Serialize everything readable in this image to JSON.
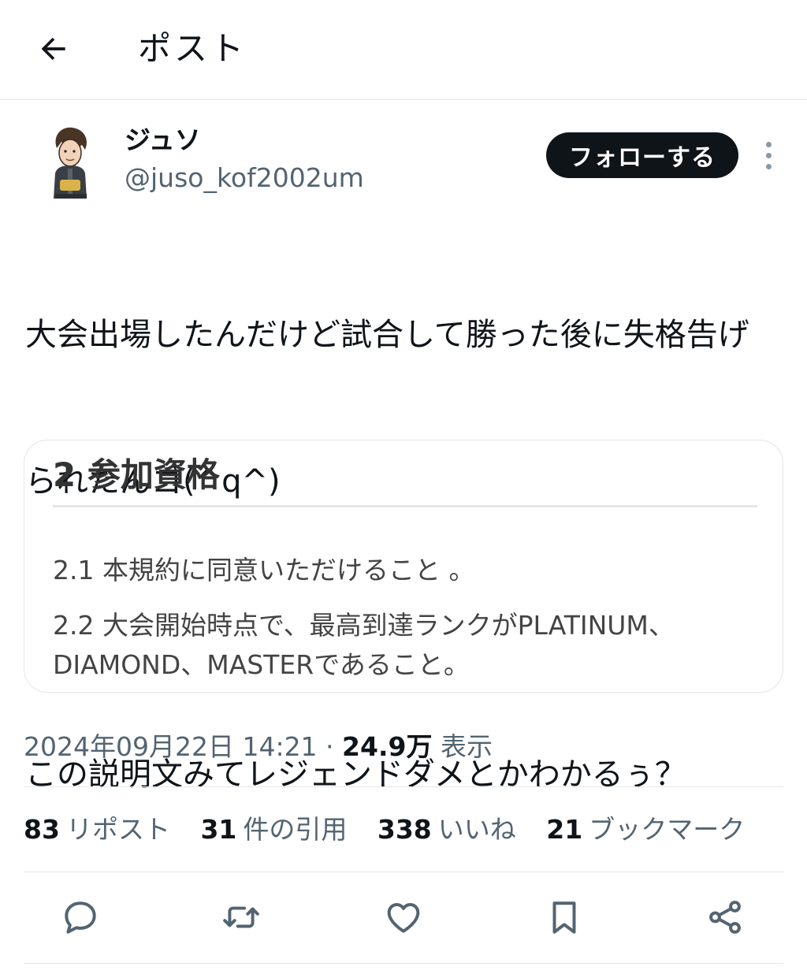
{
  "header": {
    "title": "ポスト"
  },
  "author": {
    "display_name": "ジュソ",
    "handle": "@juso_kof2002um",
    "follow_label": "フォローする"
  },
  "tweet": {
    "line1": "大会出場したんだけど試合して勝った後に失格告げ",
    "line2": "られたんゴ(^q^)",
    "line3": "この説明文みてレジェンドダメとかわかるぅ？"
  },
  "card": {
    "heading": "2 参加資格",
    "item1": "2.1 本規約に同意いただけること 。",
    "item2": "2.2 大会開始時点で、最高到達ランクがPLATINUM、DIAMOND、MASTERであること。"
  },
  "meta": {
    "datetime": "2024年09月22日 14:21",
    "separator": " · ",
    "views_count": "24.9万",
    "views_label": " 表示"
  },
  "stats": [
    {
      "count": "83",
      "label": "リポスト"
    },
    {
      "count": "31",
      "label": "件の引用"
    },
    {
      "count": "338",
      "label": "いいね"
    },
    {
      "count": "21",
      "label": "ブックマーク"
    }
  ],
  "icons": {
    "back": "arrow-left-icon",
    "more": "more-vertical-icon",
    "reply": "reply-icon",
    "repost": "repost-icon",
    "like": "heart-icon",
    "bookmark": "bookmark-icon",
    "share": "share-icon"
  },
  "colors": {
    "text": "#0f1419",
    "secondary": "#536471",
    "button_bg": "#0f1419",
    "border": "#e3e6e8"
  }
}
